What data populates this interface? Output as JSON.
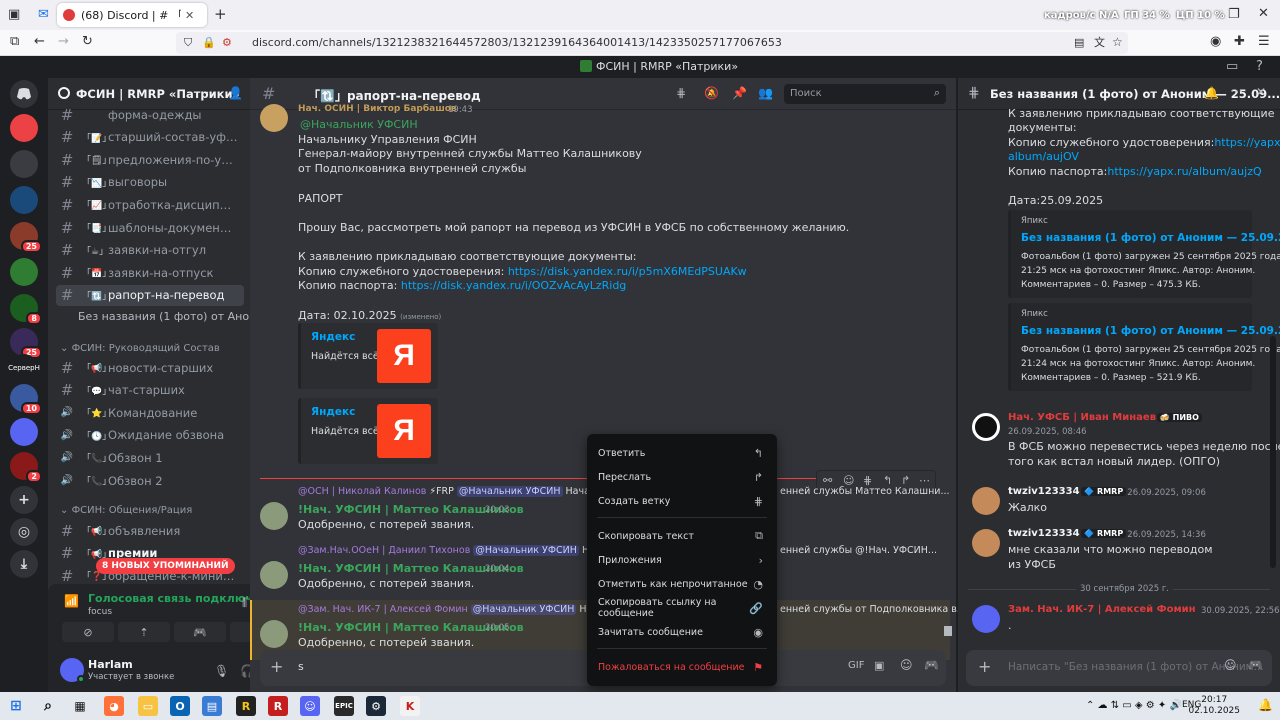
{
  "browser": {
    "tab_title": "(68) Discord | # 「🔃」рап",
    "url": "discord.com/channels/1321238321644572803/1321239164364001413/1423350257177067653",
    "overlay_stats": [
      "кадров/с N/A",
      "ГП 34 %",
      "ЦП 10 %"
    ]
  },
  "window": {
    "title": "ФСИН | RMRP «Патрики»"
  },
  "servers": [
    {
      "label": "",
      "color": "#ed4245",
      "badge": ""
    },
    {
      "label": "",
      "color": "#3a3c42",
      "badge": ""
    },
    {
      "label": "",
      "color": "#1a4a7a",
      "badge": ""
    },
    {
      "label": "",
      "color": "#8a3b2a",
      "badge": "25"
    },
    {
      "label": "",
      "color": "#2e7d32",
      "badge": ""
    },
    {
      "label": "",
      "color": "#1b5e20",
      "badge": "8"
    },
    {
      "label": "",
      "color": "#3a2a5a",
      "badge": "25"
    },
    {
      "label": "СерверН",
      "color": "#1e1f22",
      "badge": ""
    },
    {
      "label": "",
      "color": "#3a5aa0",
      "badge": "10"
    },
    {
      "label": "",
      "color": "#5865f2",
      "badge": ""
    },
    {
      "label": "",
      "color": "#8a1a1a",
      "badge": "2"
    }
  ],
  "guild": {
    "name": "ФСИН | RMRP «Патрики»"
  },
  "channels": [
    {
      "emoji": "",
      "label": "форма-одежды",
      "type": "hash",
      "state": ""
    },
    {
      "emoji": "「📝」",
      "label": "старший-состав-уфсин",
      "type": "hash",
      "state": ""
    },
    {
      "emoji": "「🗒」",
      "label": "предложения-по-улучше...",
      "type": "hash",
      "state": ""
    },
    {
      "emoji": "「📉」",
      "label": "выговоры",
      "type": "hash",
      "state": ""
    },
    {
      "emoji": "「📈」",
      "label": "отработка-дисциплинар...",
      "type": "hash",
      "state": ""
    },
    {
      "emoji": "「📑」",
      "label": "шаблоны-документации",
      "type": "hash",
      "state": ""
    },
    {
      "emoji": "「☕」",
      "label": "заявки-на-отгул",
      "type": "hash",
      "state": ""
    },
    {
      "emoji": "「📅」",
      "label": "заявки-на-отпуск",
      "type": "hash",
      "state": ""
    },
    {
      "emoji": "「🔃」",
      "label": "рапорт-на-перевод",
      "type": "hash",
      "state": "active"
    }
  ],
  "thread_item": "Без названия (1 фото) от Аноним...",
  "category1": "ФСИН: Руководящий Состав",
  "channels2": [
    {
      "emoji": "「📢」",
      "label": "новости-старших",
      "type": "hash",
      "state": ""
    },
    {
      "emoji": "「💬」",
      "label": "чат-старших",
      "type": "hash",
      "state": ""
    },
    {
      "emoji": "「⭐」",
      "label": "Командование",
      "type": "voice",
      "state": ""
    },
    {
      "emoji": "「🕓」",
      "label": "Ожидание обзвона",
      "type": "voice",
      "state": ""
    },
    {
      "emoji": "「📞」",
      "label": "Обзвон 1",
      "type": "voice",
      "state": ""
    },
    {
      "emoji": "「📞」",
      "label": "Обзвон 2",
      "type": "voice",
      "state": ""
    }
  ],
  "category2": "ФСИН: Общения/Рация",
  "channels3": [
    {
      "emoji": "「📢」",
      "label": "объявления",
      "type": "hash",
      "state": ""
    },
    {
      "emoji": "「📢」",
      "label": "премии",
      "type": "hash",
      "state": "bold"
    },
    {
      "emoji": "「❓」",
      "label": "обращение-к-министру...",
      "type": "hash",
      "state": ""
    }
  ],
  "mentions_pill": "8 НОВЫХ УПОМИНАНИЙ",
  "voice": {
    "status": "Голосовая связь подключена",
    "channel": "focus"
  },
  "user": {
    "name": "Harlam",
    "status": "Участвует в звонке"
  },
  "chat": {
    "channel_name": "「🔃」рапорт-на-перевод",
    "search_placeholder": "Поиск",
    "top_author": "Нач. ОСИН | Виктор Барбашов",
    "top_time": "19:43",
    "lines": [
      {
        "text": "@Начальник УФСИН",
        "kind": "mention"
      },
      {
        "text": "Начальнику Управления ФСИН",
        "kind": "text"
      },
      {
        "text": "Генерал-майору внутренней службы Маттео Калашникову",
        "kind": "text"
      },
      {
        "text": "от Подполковника внутренней службы",
        "kind": "text"
      },
      {
        "text": "",
        "kind": "text"
      },
      {
        "text": "РАПОРТ",
        "kind": "text"
      },
      {
        "text": "",
        "kind": "text"
      },
      {
        "text": "Прошу Вас, рассмотреть мой рапорт на перевод из УФСИН в УФСБ по собственному желанию.",
        "kind": "text"
      },
      {
        "text": "",
        "kind": "text"
      },
      {
        "text": "К заявлению прикладываю соответствующие документы:",
        "kind": "text"
      }
    ],
    "doc1_label": "Копию служебного удостоверения: ",
    "doc1_link": "https://disk.yandex.ru/i/p5mX6MEdPSUAKw",
    "doc2_label": "Копию паспорта: ",
    "doc2_link": "https://disk.yandex.ru/i/OOZvAcAyLzRidg",
    "date_text": "Дата: 02.10.2025",
    "edited": "(изменено)",
    "embeds": [
      {
        "site": "Яндекс",
        "desc": "Найдётся всё",
        "logo": "Я"
      },
      {
        "site": "Яндекс",
        "desc": "Найдётся всё",
        "logo": "Я"
      }
    ],
    "replies": [
      {
        "reply_author": "@ОСН | Николай Калинов",
        "reply_tag": "⚡FRP",
        "reply_mention": "@Начальник УФСИН",
        "reply_text": "Начальн",
        "reply_tail": "енней службы Маттео Калашни...",
        "author": "!Нач. УФСИН | Маттео Калашников",
        "time": "20:03",
        "text": "Одобренно, с потерей звания."
      },
      {
        "reply_author": "@Зам.Нач.ООеН | Даниил Тихонов",
        "reply_tag": "",
        "reply_mention": "@Начальник УФСИН",
        "reply_text": "Начальн",
        "reply_tail": "енней службы  @!Нач. УФСИН...",
        "author": "!Нач. УФСИН | Маттео Калашников",
        "time": "20:04",
        "text": "Одобренно, с потерей звания."
      },
      {
        "reply_author": "@Зам. Нач. ИК-7 | Алексей Фомин",
        "reply_tag": "",
        "reply_mention": "@Начальник УФСИН",
        "reply_text": "Начальн",
        "reply_tail": "енней службы  от Подполковника  в...",
        "author": "!Нач. УФСИН | Маттео Калашников",
        "time": "20:05",
        "text": "Одобренно, с потерей звания."
      }
    ],
    "input_value": "s"
  },
  "context_menu": [
    {
      "label": "Ответить",
      "icon": "↰",
      "danger": false
    },
    {
      "label": "Переслать",
      "icon": "↱",
      "danger": false
    },
    {
      "label": "Создать ветку",
      "icon": "⋕",
      "danger": false
    },
    {
      "label": "Скопировать текст",
      "icon": "⧉",
      "danger": false
    },
    {
      "label": "Приложения",
      "icon": "›",
      "danger": false
    },
    {
      "label": "Отметить как непрочитанное",
      "icon": "◔",
      "danger": false
    },
    {
      "label": "Скопировать ссылку на сообщение",
      "icon": "🔗",
      "danger": false
    },
    {
      "label": "Зачитать сообщение",
      "icon": "◉",
      "danger": false
    },
    {
      "label": "Пожаловаться на сообщение",
      "icon": "⚑",
      "danger": true
    }
  ],
  "thread": {
    "title": "Без названия (1 фото) от Аноним — 25.09...",
    "top_lines": [
      "К заявлению прикладываю соответствующие",
      "документы:"
    ],
    "copy_id_label": "Копию служебного удостоверения:",
    "copy_id_link1": "https://yapx.ru/",
    "copy_id_link2": "album/aujOV",
    "copy_pass_label": "Копию паспорта:",
    "copy_pass_link": "https://yapx.ru/album/aujzQ",
    "date": "Дата:25.09.2025",
    "embeds": [
      {
        "provider": "Япикс",
        "title": "Без названия (1 фото) от Аноним — 25.09.20...",
        "d1": "Фотоальбом (1 фото) загружен 25 сентября 2025 года,",
        "d2": "21:25 мск на фотохостинг Япикс. Автор: Аноним.",
        "d3": "Комментариев – 0. Размер – 475.3 КБ."
      },
      {
        "provider": "Япикс",
        "title": "Без названия (1 фото) от Аноним — 25.09.20...",
        "d1": "Фотоальбом (1 фото) загружен 25 сентября 2025 года,",
        "d2": "21:24 мск на фотохостинг Япикс. Автор: Аноним.",
        "d3": "Комментариев – 0. Размер – 521.9 КБ."
      }
    ],
    "messages": [
      {
        "author": "Нач. УФСБ | Иван Минаев",
        "tag": "🍻 ПИВО",
        "time": "26.09.2025, 08:46",
        "lines": [
          "В ФСБ можно перевестись через неделю после",
          "того как встал новый лидер. (ОПГО)"
        ],
        "author_color": "#e03c3c"
      },
      {
        "author": "twziv123334",
        "tag": "🔷 RMRP",
        "time": "26.09.2025, 09:06",
        "lines": [
          "Жалко"
        ],
        "author_color": "#f2f3f5"
      },
      {
        "author": "twziv123334",
        "tag": "🔷 RMRP",
        "time": "26.09.2025, 14:36",
        "lines": [
          "мне сказали что можно переводом",
          "из УФСБ"
        ],
        "author_color": "#f2f3f5"
      },
      {
        "author": "Зам. Нач. ИК-7 | Алексей Фомин",
        "tag": "",
        "time": "30.09.2025, 22:56",
        "lines": [
          "."
        ],
        "author_color": "#e03c3c"
      }
    ],
    "divider": "30 сентября 2025 г.",
    "input_placeholder": "Написать \"Без названия (1 фото) от Аноним..."
  },
  "taskbar": {
    "lang": "ENG",
    "time": "20:17",
    "date": "02.10.2025"
  }
}
